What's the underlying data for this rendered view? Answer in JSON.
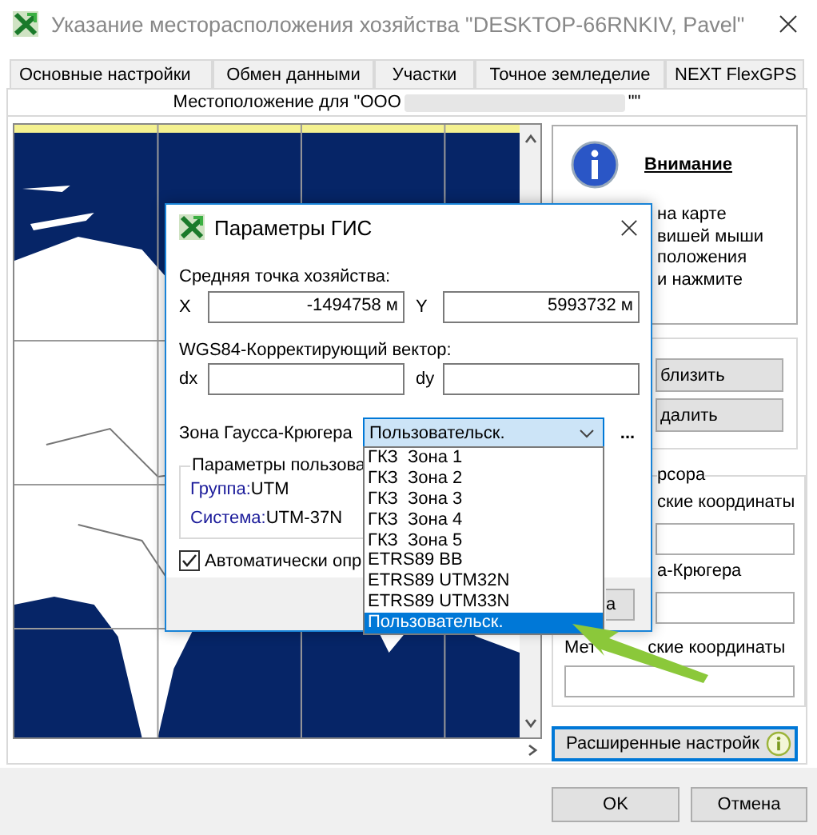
{
  "window": {
    "title": "Указание месторасположения хозяйства \"DESKTOP-66RNKIV, Pavel\""
  },
  "tabs": [
    {
      "label": "Основные настройки",
      "selected": false
    },
    {
      "label": "Обмен данными",
      "selected": false
    },
    {
      "label": "Участки",
      "selected": false
    },
    {
      "label": "Точное земледелие",
      "selected": false
    },
    {
      "label": "NEXT FlexGPS",
      "selected": false
    },
    {
      "label": "Местоположение для \"ООО",
      "after_redaction": "\"\"",
      "selected": true
    }
  ],
  "info_panel": {
    "heading": "Внимание",
    "lines": [
      "на карте",
      "вишей мыши",
      "положения",
      "и нажмите"
    ]
  },
  "zoom_buttons": [
    "близить",
    "далить"
  ],
  "cursor_group": {
    "legend": "рсора",
    "geo_label": "ские координаты",
    "gk_label": "а-Крюгера",
    "metric_label_start": "Мет",
    "metric_label_end": "ские координаты"
  },
  "advanced_button": "Расширенные настройк",
  "footer_buttons": [
    "OK",
    "Отмена"
  ],
  "dialog": {
    "title": "Параметры ГИС",
    "midpoint_label": "Средняя точка хозяйства:",
    "x_label": "X",
    "x_value": "-1494758 м",
    "y_label": "Y",
    "y_value": "5993732 м",
    "vector_label": "WGS84-Корректирующий вектор:",
    "dx_label": "dx",
    "dy_label": "dy",
    "zone_label": "Зона Гаусса-Крюгера",
    "zone_value": "Пользовательск.",
    "more_button": "...",
    "params_legend": "Параметры пользова",
    "group_label": "Группа:",
    "group_value": "UTM",
    "system_label": "Система:",
    "system_value": "UTM-37N",
    "auto_checkbox": {
      "label": "Автоматически опр",
      "checked": true
    },
    "footer_button": "а"
  },
  "zone_options": [
    {
      "label": "ГКЗ  Зона 1",
      "selected": false
    },
    {
      "label": "ГКЗ  Зона 2",
      "selected": false
    },
    {
      "label": "ГКЗ  Зона 3",
      "selected": false
    },
    {
      "label": "ГКЗ  Зона 4",
      "selected": false
    },
    {
      "label": "ГКЗ  Зона 5",
      "selected": false
    },
    {
      "label": "ETRS89 BB",
      "selected": false
    },
    {
      "label": "ETRS89 UTM32N",
      "selected": false
    },
    {
      "label": "ETRS89 UTM33N",
      "selected": false
    },
    {
      "label": "Пользовательск.",
      "selected": true
    }
  ]
}
